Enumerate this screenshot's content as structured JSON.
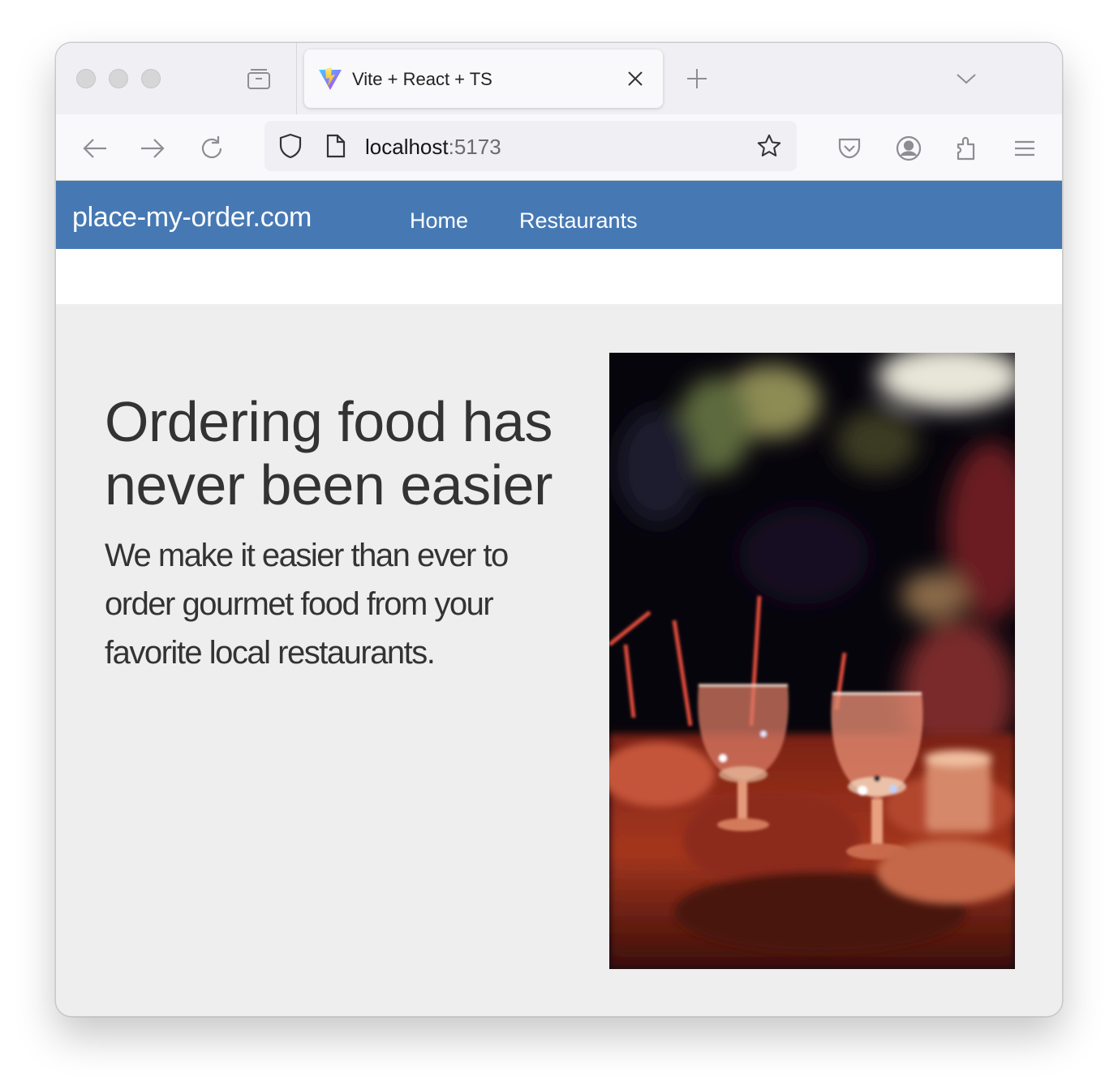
{
  "browser": {
    "tab": {
      "title": "Vite + React + TS",
      "favicon": "vite-logo-icon"
    },
    "url": {
      "host": "localhost",
      "port": ":5173"
    },
    "icons": [
      "back-arrow-icon",
      "forward-arrow-icon",
      "reload-icon",
      "shield-icon",
      "page-icon",
      "star-icon",
      "pocket-icon",
      "account-icon",
      "extensions-icon",
      "menu-icon"
    ]
  },
  "navbar": {
    "brand": "place-my-order.com",
    "links": [
      {
        "label": "Home"
      },
      {
        "label": "Restaurants"
      }
    ],
    "color": "#4679b4"
  },
  "hero": {
    "title": "Ordering food has never been easier",
    "text": "We make it easier than ever to order gourmet food from your favorite local restaurants.",
    "image": "restaurant-glasses-photo"
  }
}
